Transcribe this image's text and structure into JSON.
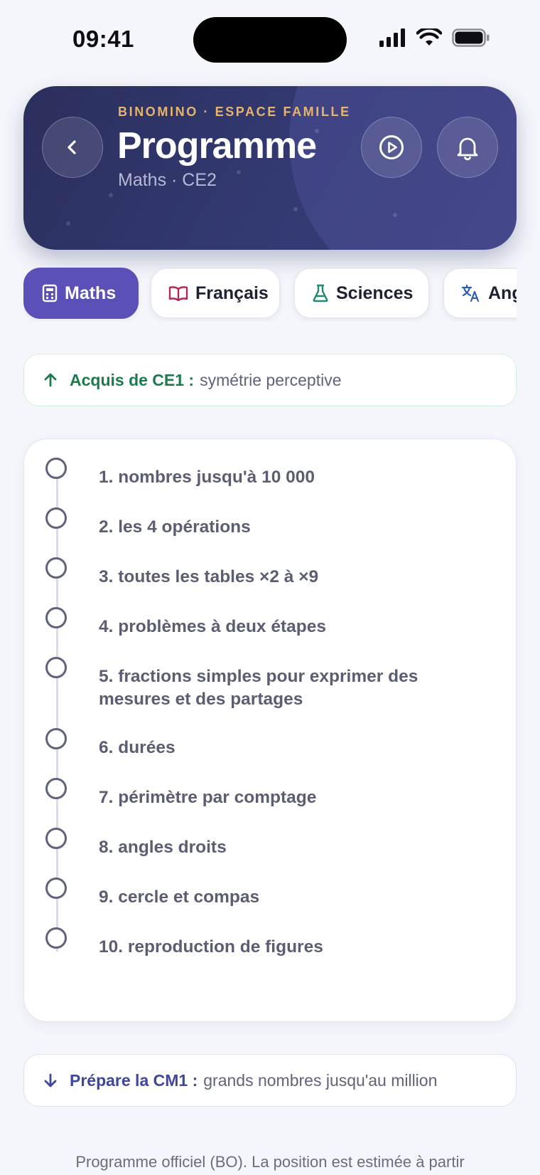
{
  "status_bar": {
    "time": "09:41"
  },
  "header": {
    "eyebrow": "BINOMINO · ESPACE FAMILLE",
    "title": "Programme",
    "subtitle": "Maths · CE2"
  },
  "tabs": [
    {
      "label": "Maths",
      "icon": "calculator-icon",
      "active": true
    },
    {
      "label": "Français",
      "icon": "book-icon",
      "active": false
    },
    {
      "label": "Sciences",
      "icon": "flask-icon",
      "active": false
    },
    {
      "label": "Anglais",
      "icon": "translate-icon",
      "active": false
    }
  ],
  "previous": {
    "label": "Acquis de CE1 :",
    "value": "symétrie perceptive"
  },
  "items": [
    "1. nombres jusqu'à 10 000",
    "2. les 4 opérations",
    "3. toutes les tables ×2 à ×9",
    "4. problèmes à deux étapes",
    "5. fractions simples pour exprimer des mesures et des partages",
    "6. durées",
    "7. périmètre par comptage",
    "8. angles droits",
    "9. cercle et compas",
    "10. reproduction de figures"
  ],
  "next": {
    "label": "Prépare la CM1 :",
    "value": "grands nombres jusqu'au million"
  },
  "footnote": "Programme officiel (BO). La position est estimée à partir",
  "colors": {
    "accent": "#5b4fb8",
    "header_bg": "#2f3568",
    "eyebrow": "#e7b46d",
    "prev_green": "#1d7a4d",
    "next_blue": "#3f46a0"
  }
}
